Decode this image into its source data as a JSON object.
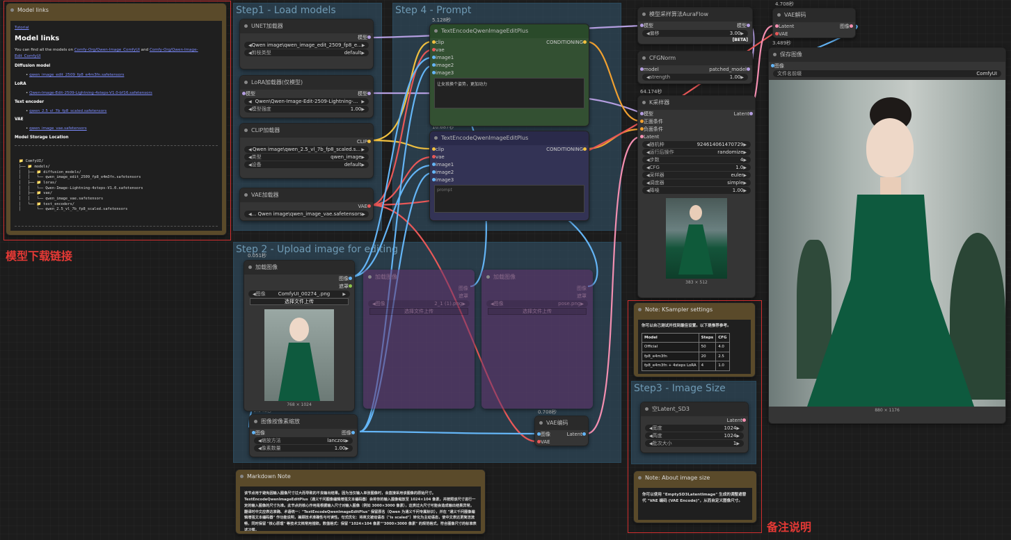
{
  "groups": {
    "step1": "Step1 - Load models",
    "step4": "Step 4 - Prompt",
    "step2": "Step 2 - Upload image for editing",
    "step3": "Step3 - Image Size"
  },
  "model_links": {
    "title": "Model links",
    "tab": "Tutorial",
    "heading": "Model links",
    "intro_text": "You can find all the models on",
    "intro_link1": "Comfy-Org/Qwen-Image_ComfyUI",
    "intro_and": "and",
    "intro_link2": "Comfy-Org/Qwen-Image-Edit_ComfyUI",
    "diffusion_label": "Diffusion model",
    "diffusion_file": "qwen_image_edit_2509_fp8_e4m3fn.safetensors",
    "lora_label": "LoRA",
    "lora_file": "Qwen-Image-Edit-2509-Lightning-4steps-V1.0-bf16.safetensors",
    "text_encoder_label": "Text encoder",
    "text_encoder_file": "qwen_2.5_vl_7b_fp8_scaled.safetensors",
    "vae_label": "VAE",
    "vae_file": "qwen_image_vae.safetensors",
    "storage_label": "Model Storage Location",
    "tree": [
      "📁 ComfyUI/",
      "├── 📁 models/",
      "│   ├── 📁 diffusion_models/",
      "│   │   └── qwen_image_edit_2509_fp8_e4m3fn.safetensors",
      "│   ├── 📁 loras/",
      "│   │   └── Qwen-Image-Lightning-4steps-V1.0.safetensors",
      "│   ├── 📁 vae/",
      "│   │   └── qwen_image_vae.safetensors",
      "│   └── 📁 text_encoders/",
      "│       └── qwen_2.5_vl_7b_fp8_scaled.safetensors"
    ]
  },
  "annotations": {
    "model_download": "模型下载链接",
    "notes": "备注说明"
  },
  "unet": {
    "title": "UNET加载器",
    "out": "模型",
    "unet_name": "Qwen image\\qwen_image_edit_2509_fp8_e...",
    "dtype_label": "剪枝类型",
    "dtype_value": "default"
  },
  "lora": {
    "title": "LoRA加载器(仅模型)",
    "in": "模型",
    "out": "模型",
    "lora_name": "Qwen\\Qwen-Image-Edit-2509-Lightning-...",
    "strength_label": "模型强度",
    "strength_value": "1.00"
  },
  "clip": {
    "title": "CLIP加载器",
    "out": "CLIP",
    "clip_name": "Qwen image\\qwen_2.5_vl_7b_fp8_scaled.s...",
    "type_label": "类型",
    "type_value": "qwen_image",
    "device_label": "设备",
    "device_value": "default"
  },
  "vae_loader": {
    "title": "VAE加载器",
    "out": "VAE",
    "vae_name": "... Qwen image\\qwen_image_vae.safetensors"
  },
  "te_pos": {
    "time": "5.128秒",
    "title": "TextEncodeQwenImageEditPlus",
    "in": [
      "clip",
      "vae",
      "image1",
      "image2",
      "image3"
    ],
    "out": "CONDITIONING",
    "prompt": "让女孩换个姿势，更加动力"
  },
  "te_neg": {
    "time": "10.687秒",
    "title": "TextEncodeQwenImageEditPlus",
    "in": [
      "clip",
      "vae",
      "image1",
      "image2",
      "image3"
    ],
    "out": "CONDITIONING",
    "prompt": "prompt"
  },
  "aura": {
    "title": "模型采样算法AuraFlow",
    "in": "模型",
    "out": "模型",
    "shift_label": "偏移",
    "shift_value": "3.00",
    "beta": "[BETA]"
  },
  "cfgnorm": {
    "title": "CFGNorm",
    "in": "model",
    "out": "patched_model",
    "strength_label": "strength",
    "strength_value": "1.00"
  },
  "ksampler": {
    "time": "64.174秒",
    "title": "K采样器",
    "inputs": [
      "模型",
      "正面条件",
      "负面条件",
      "Latent"
    ],
    "out": "Latent",
    "widgets": [
      {
        "label": "随机种",
        "value": "924614061470729"
      },
      {
        "label": "运行后操作",
        "value": "randomize"
      },
      {
        "label": "步数",
        "value": "4"
      },
      {
        "label": "CFG",
        "value": "1.0"
      },
      {
        "label": "采样器",
        "value": "euler"
      },
      {
        "label": "调度器",
        "value": "simple"
      },
      {
        "label": "降噪",
        "value": "1.00"
      }
    ],
    "preview_size": "383 × 512"
  },
  "vae_decode": {
    "time": "4.708秒",
    "title": "VAE解码",
    "in1": "Latent",
    "in2": "VAE",
    "out": "图像"
  },
  "save": {
    "time": "3.489秒",
    "title": "保存图像",
    "in": "图像",
    "prefix_label": "文件名前缀",
    "prefix_value": "ComfyUI",
    "size": "880 × 1176"
  },
  "load_image": {
    "time": "0.051秒",
    "title": "加载图像",
    "out1": "图像",
    "out2": "遮罩",
    "image_label": "图像",
    "image_value": "ComfyUI_00274_.png",
    "upload": "选择文件上传",
    "size": "768 × 1024"
  },
  "load_image2": {
    "title": "加载图像",
    "out1": "图像",
    "out2": "遮罩",
    "image_label": "图像",
    "image_value": "2_1 (1).png",
    "upload": "选择文件上传"
  },
  "load_image3": {
    "title": "加载图像",
    "out1": "图像",
    "out2": "遮罩",
    "image_label": "图像",
    "image_value": "pose.png",
    "upload": "选择文件上传"
  },
  "scale": {
    "time": "0.048秒",
    "title": "图像按像素缩放",
    "in": "图像",
    "out": "图像",
    "method_label": "缩放方法",
    "method_value": "lanczos",
    "mp_label": "像素数量",
    "mp_value": "1.00"
  },
  "vae_encode": {
    "time": "0.708秒",
    "title": "VAE编码",
    "in1": "图像",
    "in2": "VAE",
    "out": "Latent"
  },
  "note_ks": {
    "title": "Note: KSampler settings",
    "text": "你可以自己测试并找到最佳设置。以下是推荐参考。",
    "headers": [
      "Model",
      "Steps",
      "CFG"
    ],
    "rows": [
      [
        "Official",
        "50",
        "4.0"
      ],
      [
        "fp8_e4m3fn",
        "20",
        "2.5"
      ],
      [
        "fp8_e4m3fn + 4steps LoRA",
        "4",
        "1.0"
      ]
    ]
  },
  "latent": {
    "title": "空Latent_SD3",
    "out": "Latent",
    "width_label": "宽度",
    "width_value": "1024",
    "height_label": "高度",
    "height_value": "1024",
    "batch_label": "批次大小",
    "batch_value": "1"
  },
  "note_size": {
    "title": "Note: About image size",
    "text": "你可以使用 \"EmptySD3LatentImage\" 生成的调整遮替代 \"VAE 编码 (VAE Encode)\"，从而自定义图像尺寸。"
  },
  "markdown": {
    "title": "Markdown Note",
    "text": "该节点用于避免因输入图像尺寸过大而导致的不良输出结果。因为当仅输入单张图像时，会直接采用该图像的原始尺寸。TextEncodeQwenImageEditPlus（通义千问图像编辑增强文本编码器）会将你的输入图像缩放至 1024×104 像素，并按照该尺寸进行一定的输入图像的尺寸为准。此节点的核心作用是根据输入尺寸对输入图像（例如 3000×3000 像素），这类过大尺寸可能会造成输出结果异常。翻译时中文应表达准确、术语统一：\"TextEncodeQwenImageEditPlus\" 保留原名（Qwen 为通义千问专属标识），并在 \"通义千问图像编辑增强文本编码器\" 作功能说明，兼顾技术准确性与可读性。句式优化：将英文被动语态（\"is scaled\"）转化为主动语态，使中文表达更简洁流畅，同时保留 \"核心原理\" 等技术文档常用措辞。数值格式：保留 \"1024×104 像素\"\"3000×3000 像素\" 的规范格式，符合图像尺寸的标准表述习惯。"
  }
}
